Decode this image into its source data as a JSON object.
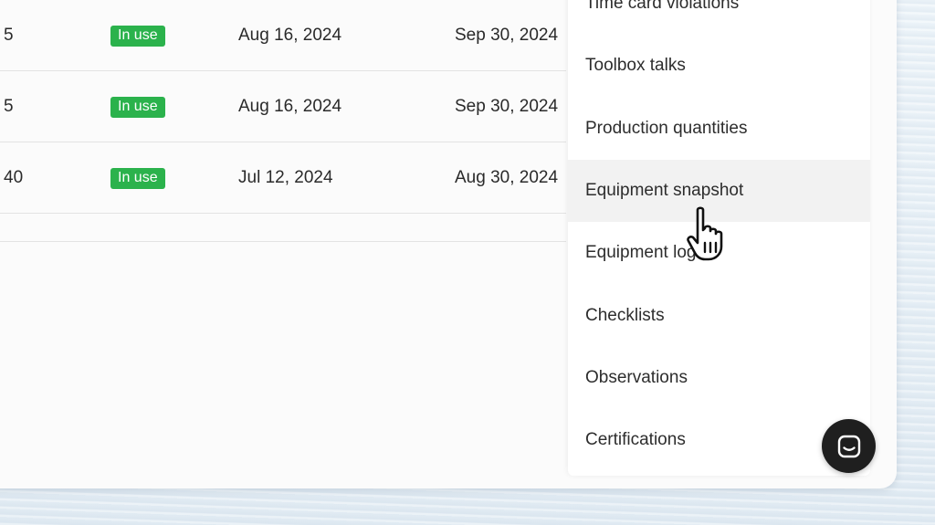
{
  "table": {
    "rows": [
      {
        "quantity": "5",
        "status": "In use",
        "start_date": "Aug 16, 2024",
        "end_date": "Sep 30, 2024"
      },
      {
        "quantity": "5",
        "status": "In use",
        "start_date": "Aug 16, 2024",
        "end_date": "Sep 30, 2024"
      },
      {
        "quantity": "40",
        "status": "In use",
        "start_date": "Jul 12, 2024",
        "end_date": "Aug 30, 2024"
      }
    ]
  },
  "menu": {
    "items": [
      {
        "label": "Time card violations"
      },
      {
        "label": "Toolbox talks"
      },
      {
        "label": "Production quantities"
      },
      {
        "label": "Equipment snapshot",
        "hovered": true
      },
      {
        "label": "Equipment logs"
      },
      {
        "label": "Checklists"
      },
      {
        "label": "Observations"
      },
      {
        "label": "Certifications"
      }
    ]
  },
  "chat": {
    "icon": "chat-bubble-icon"
  },
  "cursor": {
    "icon": "pointer-hand-icon"
  },
  "colors": {
    "badge_green": "#2bb24c",
    "hover_gray": "#f2f2f2",
    "chat_button": "#1f1f1f",
    "background": "#e7f0f7"
  }
}
